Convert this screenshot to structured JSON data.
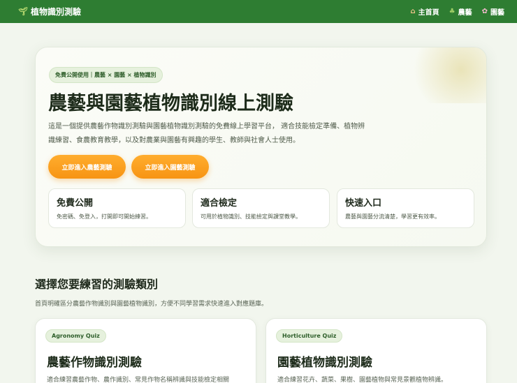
{
  "header": {
    "brand_icon": "sprout-icon",
    "brand_label": "植物識別測驗",
    "nav": [
      {
        "icon": "house-icon",
        "label": "主首頁"
      },
      {
        "icon": "farm-icon",
        "label": "農藝"
      },
      {
        "icon": "flower-icon",
        "label": "園藝"
      }
    ]
  },
  "hero": {
    "badge": "免費公開使用｜農藝 × 園藝 × 植物識別",
    "title": "農藝與園藝植物識別線上測驗",
    "description": "這是一個提供農藝作物識別測驗與園藝植物識別測驗的免費線上學習平台， 適合技能檢定準備、植物辨識練習、食農教育教學，以及對農業與園藝有興趣的學生、教師與社會人士使用。",
    "buttons": [
      {
        "label": "立即進入農藝測驗"
      },
      {
        "label": "立即進入園藝測驗"
      }
    ],
    "features": [
      {
        "title": "免費公開",
        "desc": "免密碼、免登入，打開即可開始練習。"
      },
      {
        "title": "適合檢定",
        "desc": "可用於植物識別、技能檢定與課堂教學。"
      },
      {
        "title": "快速入口",
        "desc": "農藝與園藝分流清楚，學習更有效率。"
      }
    ]
  },
  "section": {
    "title": "選擇您要練習的測驗類別",
    "desc": "首頁明確區分農藝作物識別與園藝植物識別，方便不同學習需求快速進入對應題庫。"
  },
  "quizzes": [
    {
      "tag": "Agronomy Quiz",
      "title": "農藝作物識別測驗",
      "desc": "適合練習農藝作物、農作識別、常見作物名稱辨識與技能檢定相關"
    },
    {
      "tag": "Horticulture Quiz",
      "title": "園藝植物識別測驗",
      "desc": "適合練習花卉、蔬菜、果樹、園藝植物與常見景觀植物辨識。"
    }
  ],
  "colors": {
    "header_bg": "#2e7d32",
    "accent_orange": "#f79413",
    "page_bg": "#f2f6ee"
  }
}
